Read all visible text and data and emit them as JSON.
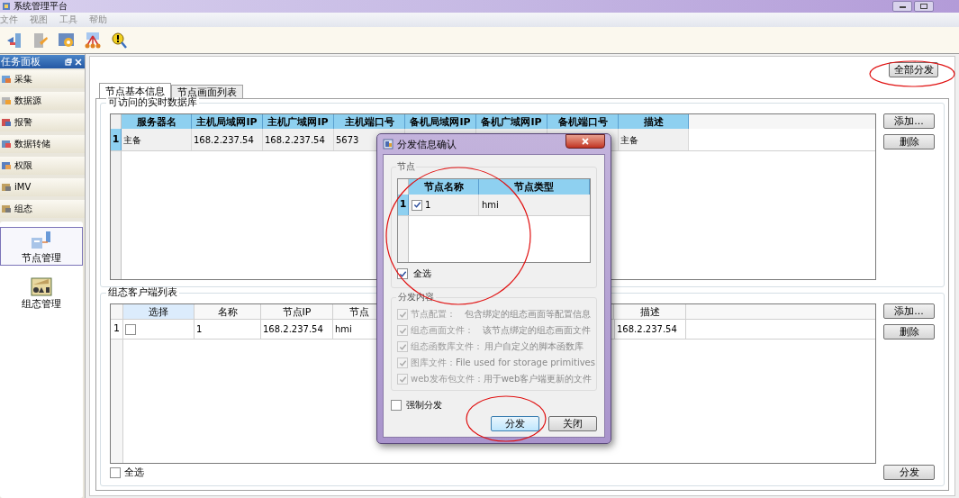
{
  "window": {
    "title": "系统管理平台"
  },
  "menu": [
    "文件",
    "视图",
    "工具",
    "帮助"
  ],
  "task_panel": {
    "title": "任务面板",
    "items": [
      {
        "label": "采集"
      },
      {
        "label": "数据源"
      },
      {
        "label": "报警"
      },
      {
        "label": "数据转储"
      },
      {
        "label": "权限"
      },
      {
        "label": "iMV"
      },
      {
        "label": "组态"
      }
    ],
    "modules": [
      {
        "label": "节点管理",
        "selected": true
      },
      {
        "label": "组态管理",
        "selected": false
      }
    ]
  },
  "distribute_all_button": "全部分发",
  "tabs": [
    {
      "label": "节点基本信息",
      "selected": true
    },
    {
      "label": "节点画面列表",
      "selected": false
    }
  ],
  "database_group": {
    "title": "可访问的实时数据库",
    "columns": [
      "服务器名",
      "主机局域网IP",
      "主机广域网IP",
      "主机端口号",
      "备机局域网IP",
      "备机广域网IP",
      "备机端口号",
      "描述"
    ],
    "rows": [
      {
        "number": "1",
        "selected": true,
        "server_name": "主备",
        "host_lan_ip": "168.2.237.54",
        "host_wan_ip": "168.2.237.54",
        "host_port": "5673",
        "description": "主备"
      }
    ],
    "buttons": [
      "添加...",
      "删除"
    ]
  },
  "client_group": {
    "title": "组态客户端列表",
    "columns": [
      "选择",
      "名称",
      "节点IP",
      "节点"
    ],
    "description_column": "描述",
    "rows": [
      {
        "number": "1",
        "checked": false,
        "name": "1",
        "node_ip": "168.2.237.54",
        "node_type": "hmi",
        "description": "168.2.237.54"
      }
    ],
    "buttons": [
      "添加...",
      "删除"
    ],
    "select_all": {
      "label": "全选",
      "checked": false
    },
    "distribute_button": "分发"
  },
  "dialog": {
    "title": "分发信息确认",
    "nodes_group": {
      "title": "节点",
      "columns": [
        "节点名称",
        "节点类型"
      ],
      "rows": [
        {
          "number": "1",
          "checked": true,
          "name": "1",
          "type": "hmi"
        }
      ],
      "select_all": {
        "label": "全选",
        "checked": true
      }
    },
    "content_group": {
      "title": "分发内容",
      "items": [
        {
          "label": "节点配置：",
          "description": "包含绑定的组态画面等配置信息",
          "checked": true,
          "disabled": true
        },
        {
          "label": "组态画面文件：",
          "description": "该节点绑定的组态画面文件",
          "checked": true,
          "disabled": true
        },
        {
          "label": "组态函数库文件：",
          "description": "用户自定义的脚本函数库",
          "checked": true,
          "disabled": true
        },
        {
          "label": "图库文件：",
          "description": "File used for storage  primitives",
          "checked": true,
          "disabled": true
        },
        {
          "label": "web发布包文件：",
          "description": "用于web客户端更新的文件",
          "checked": true,
          "disabled": true
        }
      ]
    },
    "force": {
      "label": "强制分发",
      "checked": false
    },
    "buttons": [
      {
        "label": "分发",
        "kind": "primary"
      },
      {
        "label": "关闭",
        "kind": "normal"
      }
    ]
  }
}
